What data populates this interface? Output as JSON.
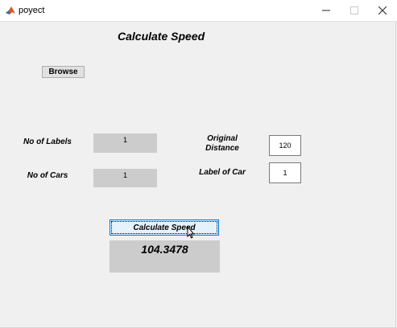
{
  "window": {
    "title": "poyect",
    "minimize_glyph": "—",
    "maximize_glyph": "☐",
    "close_glyph": "✕"
  },
  "app": {
    "heading": "Calculate Speed",
    "browse_label": "Browse",
    "no_of_labels_label": "No of Labels",
    "no_of_labels_value": "1",
    "no_of_cars_label": "No of Cars",
    "no_of_cars_value": "1",
    "original_distance_label_line1": "Original",
    "original_distance_label_line2": "Distance",
    "original_distance_value": "120",
    "label_of_car_label": "Label of Car",
    "label_of_car_value": "1",
    "calculate_label": "Calculate Speed",
    "result_value": "104.3478"
  },
  "icons": {
    "app_icon": "matlab-icon",
    "cursor": "mouse-pointer-icon"
  },
  "colors": {
    "window_bg": "#f0f0f0",
    "readout_bg": "#cccccc",
    "focused_button_border": "#0078d7",
    "focused_button_bg": "#e5f1fb"
  }
}
